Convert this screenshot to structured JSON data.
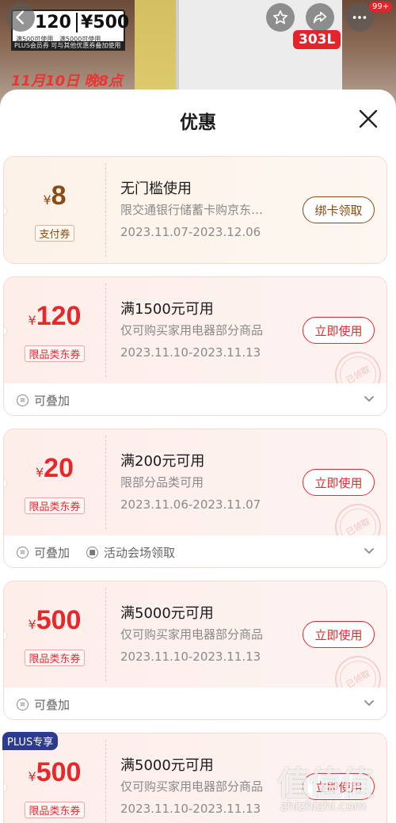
{
  "promo_banner": {
    "price1": "120",
    "price2": "¥500",
    "small1": "满500可使用",
    "small2": "满5000可使用",
    "plus_strip": "PLUS会员券",
    "plus_strip2": "可与其他优惠券叠加使用",
    "event_date": "11月10日 晚8点",
    "capacity": "303L"
  },
  "nav": {
    "cart_count": "99+"
  },
  "sheet": {
    "title": "优惠"
  },
  "coupons": [
    {
      "yen": "¥",
      "amount": "8",
      "tag": "支付券",
      "condition": "无门槛使用",
      "desc": "限交通银行储蓄卡购京东…",
      "date": "2023.11.07-2023.12.06",
      "action": "绑卡领取"
    },
    {
      "yen": "¥",
      "amount": "120",
      "tag": "限品类东券",
      "condition": "满1500元可用",
      "desc": "仅可购买家用电器部分商品",
      "date": "2023.11.10-2023.11.13",
      "action": "立即使用",
      "stamp": "已领取",
      "foot": [
        "可叠加"
      ]
    },
    {
      "yen": "¥",
      "amount": "20",
      "tag": "限品类东券",
      "condition": "满200元可用",
      "desc": "限部分品类可用",
      "date": "2023.11.06-2023.11.07",
      "action": "立即使用",
      "stamp": "已领取",
      "foot": [
        "可叠加",
        "活动会场领取"
      ]
    },
    {
      "yen": "¥",
      "amount": "500",
      "tag": "限品类东券",
      "condition": "满5000元可用",
      "desc": "仅可购买家用电器部分商品",
      "date": "2023.11.10-2023.11.13",
      "action": "立即使用",
      "stamp": "已领取",
      "foot": [
        "可叠加"
      ]
    },
    {
      "yen": "¥",
      "amount": "500",
      "tag": "限品类东券",
      "condition": "满5000元可用",
      "desc": "仅可购买家用电器部分商品",
      "date": "2023.11.10-2023.11.13",
      "action": "立即使用",
      "badge": "PLUS专享"
    }
  ],
  "watermark": {
    "logo": "值值值",
    "url": "zhizhizhi.com"
  },
  "colors": {
    "coupon_red": "#e6282b",
    "coupon_brown": "#8a4a14",
    "plus_blue": "#2d3b8f"
  }
}
